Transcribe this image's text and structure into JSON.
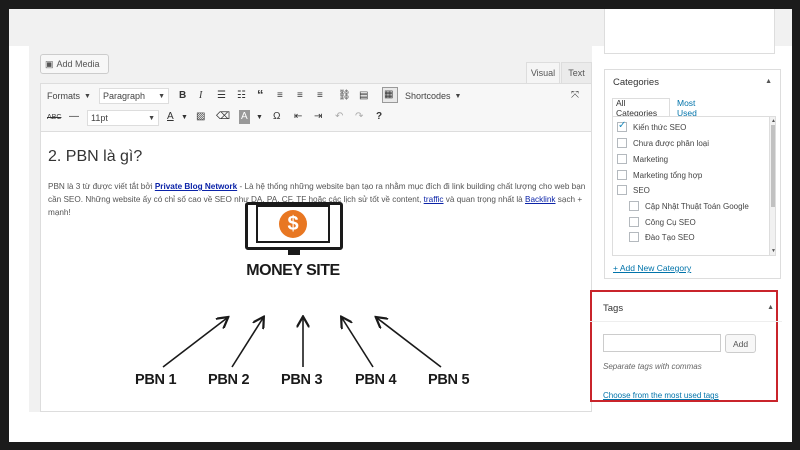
{
  "editor": {
    "add_media": "Add Media",
    "tabs": {
      "visual": "Visual",
      "text": "Text"
    },
    "toolbar": {
      "formats": "Formats",
      "paragraph": "Paragraph",
      "shortcodes": "Shortcodes",
      "font_size": "11pt"
    },
    "heading": "2. PBN là gì?",
    "paragraph": {
      "before_link1": "PBN là 3 từ được viết tắt bởi ",
      "link1": "Private Blog Network",
      "after_link1": " - Là hệ thống những website bạn tạo ra nhằm mục đích đi link building chất lượng cho web bạn cần SEO. Những website ấy có chỉ số cao về SEO như DA, PA, CF, TF hoặc các lịch sử tốt về content, ",
      "link2": "traffic",
      "middle": " và quan trọng nhất là ",
      "link3": "Backlink",
      "end": " sạch + mạnh!"
    },
    "diagram": {
      "currency_symbol": "$",
      "center_label": "MONEY SITE",
      "nodes": [
        "PBN 1",
        "PBN 2",
        "PBN 3",
        "PBN 4",
        "PBN 5"
      ]
    }
  },
  "categories": {
    "title": "Categories",
    "tab_all": "All Categories",
    "tab_most": "Most Used",
    "items": [
      {
        "label": "Kiến thức SEO",
        "checked": true,
        "indent": false
      },
      {
        "label": "Chưa được phân loại",
        "checked": false,
        "indent": false
      },
      {
        "label": "Marketing",
        "checked": false,
        "indent": false
      },
      {
        "label": "Marketing tổng hợp",
        "checked": false,
        "indent": false
      },
      {
        "label": "SEO",
        "checked": false,
        "indent": false
      },
      {
        "label": "Cập Nhật Thuật Toán Google",
        "checked": false,
        "indent": true
      },
      {
        "label": "Công Cụ SEO",
        "checked": false,
        "indent": true
      },
      {
        "label": "Đào Tạo SEO",
        "checked": false,
        "indent": true
      }
    ],
    "add_new": "+ Add New Category"
  },
  "tags": {
    "title": "Tags",
    "input_value": "",
    "add_button": "Add",
    "help": "Separate tags with commas",
    "choose": "Choose from the most used tags"
  },
  "colors": {
    "highlight_border": "#c9242b",
    "dollar": "#e87722",
    "link": "#0073aa"
  }
}
